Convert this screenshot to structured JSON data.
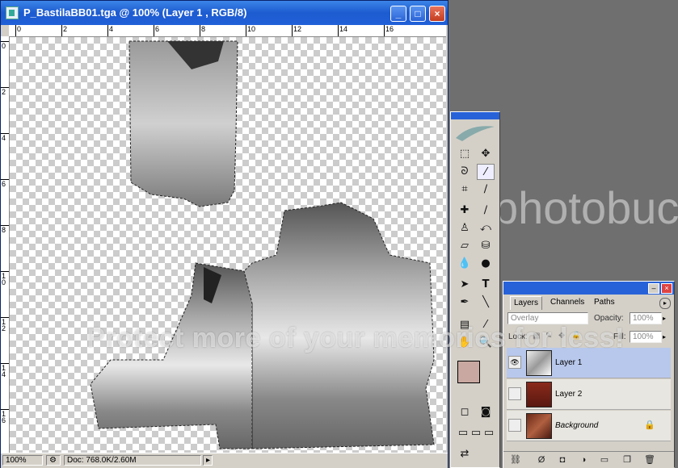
{
  "window": {
    "title": "P_BastilaBB01.tga @ 100% (Layer 1 , RGB/8)",
    "buttons": [
      "_",
      "□",
      "×"
    ]
  },
  "ruler": {
    "top_labels": [
      "0",
      "2",
      "4",
      "6",
      "8",
      "10",
      "12",
      "14",
      "16"
    ],
    "left_labels": [
      "0",
      "2",
      "4",
      "6",
      "8",
      "1\n0",
      "1\n2",
      "1\n4",
      "1\n6"
    ]
  },
  "status": {
    "zoom": "100%",
    "doc": "Doc: 768.0K/2.60M"
  },
  "toolbox": {
    "tools": [
      "marquee-tool",
      "move-tool",
      "lasso-tool",
      "magic-wand-tool",
      "crop-tool",
      "slice-tool",
      "healing-brush-tool",
      "brush-tool",
      "clone-stamp-tool",
      "history-brush-tool",
      "eraser-tool",
      "paint-bucket-tool",
      "blur-tool",
      "dodge-tool",
      "path-select-tool",
      "type-tool",
      "pen-tool",
      "line-tool",
      "notes-tool",
      "eyedropper-tool",
      "hand-tool",
      "zoom-tool"
    ]
  },
  "layers_panel": {
    "tabs": [
      "Layers",
      "Channels",
      "Paths"
    ],
    "blend_mode": "Overlay",
    "opacity_label": "Opacity:",
    "opacity_value": "100%",
    "lock_label": "Lock:",
    "fill_label": "Fill:",
    "fill_value": "100%",
    "layers": [
      {
        "name": "Layer 1",
        "selected": true,
        "visible": true
      },
      {
        "name": "Layer 2",
        "selected": false,
        "visible": false
      },
      {
        "name": "Background",
        "selected": false,
        "visible": false,
        "locked": true
      }
    ]
  },
  "colors": {
    "foreground": "#c8a8a0",
    "background": "#ffffff"
  },
  "watermark": {
    "text": "Protect more of your memories for less!",
    "logo": "photobucket"
  }
}
